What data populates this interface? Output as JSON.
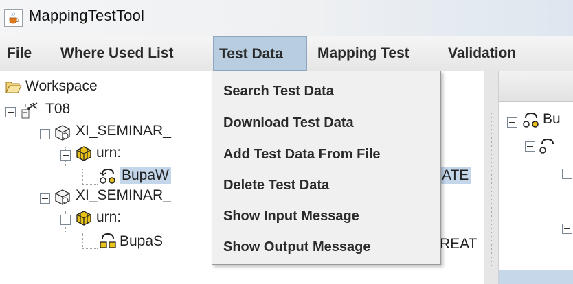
{
  "window": {
    "title": "MappingTestTool",
    "icon": "java-cup-icon"
  },
  "menubar": {
    "items": [
      {
        "label": "File"
      },
      {
        "label": "Where Used List"
      },
      {
        "label": "Test Data",
        "active": true
      },
      {
        "label": "Mapping Test"
      },
      {
        "label": "Validation"
      }
    ]
  },
  "dropdown": {
    "items": [
      {
        "label": "Search Test Data"
      },
      {
        "label": "Download Test Data"
      },
      {
        "label": "Add Test Data From File"
      },
      {
        "label": "Delete Test Data"
      },
      {
        "label": "Show Input Message"
      },
      {
        "label": "Show Output Message"
      }
    ]
  },
  "tree": {
    "workspace": "Workspace",
    "system": "T08",
    "swc1": "XI_SEMINAR_",
    "ns1": "urn:",
    "node1": "BupaW",
    "node1_tail": "ATE",
    "swc2": "XI_SEMINAR_",
    "ns2": "urn:",
    "node2": "BupaS",
    "node2_tail": "REAT"
  },
  "right_tree": {
    "node1": "Bu"
  },
  "colors": {
    "menu_active_bg": "#b9cde0",
    "selection_bg": "#c3d6ea"
  }
}
